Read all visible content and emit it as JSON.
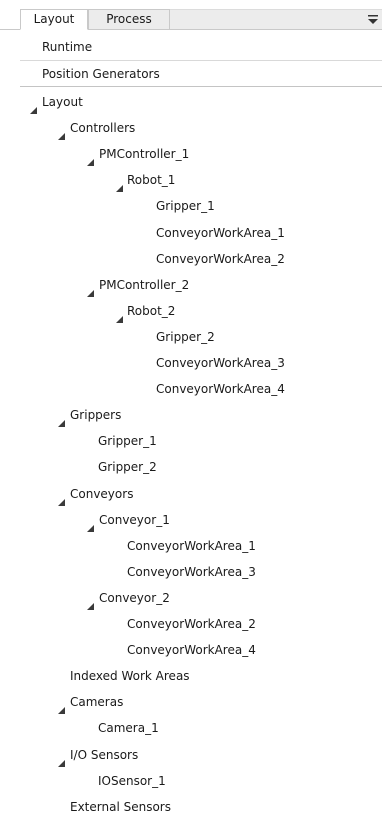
{
  "tabs": [
    {
      "label": "Layout",
      "active": true
    },
    {
      "label": "Process",
      "active": false
    }
  ],
  "top_items": [
    "Runtime",
    "Position Generators"
  ],
  "tree": [
    {
      "label": "Layout",
      "depth": 0,
      "expandable": true
    },
    {
      "label": "Controllers",
      "depth": 1,
      "expandable": true
    },
    {
      "label": "PMController_1",
      "depth": 2,
      "expandable": true
    },
    {
      "label": "Robot_1",
      "depth": 3,
      "expandable": true
    },
    {
      "label": "Gripper_1",
      "depth": 4,
      "expandable": false
    },
    {
      "label": "ConveyorWorkArea_1",
      "depth": 4,
      "expandable": false
    },
    {
      "label": "ConveyorWorkArea_2",
      "depth": 4,
      "expandable": false
    },
    {
      "label": "PMController_2",
      "depth": 2,
      "expandable": true
    },
    {
      "label": "Robot_2",
      "depth": 3,
      "expandable": true
    },
    {
      "label": "Gripper_2",
      "depth": 4,
      "expandable": false
    },
    {
      "label": "ConveyorWorkArea_3",
      "depth": 4,
      "expandable": false
    },
    {
      "label": "ConveyorWorkArea_4",
      "depth": 4,
      "expandable": false
    },
    {
      "label": "Grippers",
      "depth": 1,
      "expandable": true
    },
    {
      "label": "Gripper_1",
      "depth": 2,
      "expandable": false
    },
    {
      "label": "Gripper_2",
      "depth": 2,
      "expandable": false
    },
    {
      "label": "Conveyors",
      "depth": 1,
      "expandable": true
    },
    {
      "label": "Conveyor_1",
      "depth": 2,
      "expandable": true
    },
    {
      "label": "ConveyorWorkArea_1",
      "depth": 3,
      "expandable": false
    },
    {
      "label": "ConveyorWorkArea_3",
      "depth": 3,
      "expandable": false
    },
    {
      "label": "Conveyor_2",
      "depth": 2,
      "expandable": true
    },
    {
      "label": "ConveyorWorkArea_2",
      "depth": 3,
      "expandable": false
    },
    {
      "label": "ConveyorWorkArea_4",
      "depth": 3,
      "expandable": false
    },
    {
      "label": "Indexed Work Areas",
      "depth": 1,
      "expandable": false
    },
    {
      "label": "Cameras",
      "depth": 1,
      "expandable": true
    },
    {
      "label": "Camera_1",
      "depth": 2,
      "expandable": false
    },
    {
      "label": "I/O Sensors",
      "depth": 1,
      "expandable": true
    },
    {
      "label": "IOSensor_1",
      "depth": 2,
      "expandable": false
    },
    {
      "label": "External Sensors",
      "depth": 1,
      "expandable": false
    }
  ],
  "icons": {
    "expanded": "expanded-triangle-icon",
    "menu": "dropdown-menu-icon"
  }
}
